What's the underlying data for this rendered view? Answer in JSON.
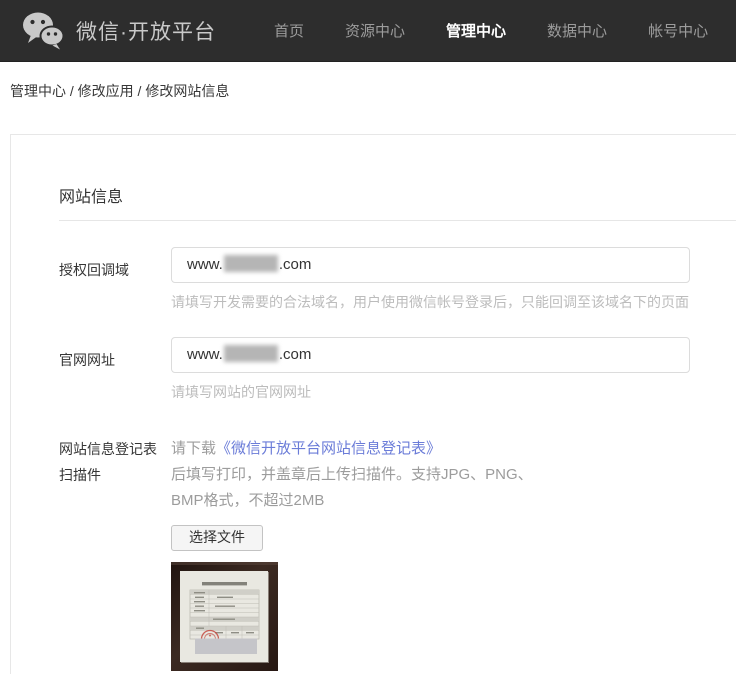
{
  "header": {
    "brand": "微信·开放平台",
    "nav": [
      {
        "label": "首页",
        "active": false
      },
      {
        "label": "资源中心",
        "active": false
      },
      {
        "label": "管理中心",
        "active": true
      },
      {
        "label": "数据中心",
        "active": false
      },
      {
        "label": "帐号中心",
        "active": false
      }
    ]
  },
  "breadcrumb": {
    "items": [
      "管理中心",
      "修改应用",
      "修改网站信息"
    ],
    "separator": " / "
  },
  "panel": {
    "section_title": "网站信息",
    "callback_domain": {
      "label": "授权回调域",
      "value_prefix": "www.",
      "value_redacted": "[redacted]",
      "value_suffix": ".com",
      "hint": "请填写开发需要的合法域名，用户使用微信帐号登录后，只能回调至该域名下的页面"
    },
    "site_url": {
      "label": "官网网址",
      "value_prefix": "www.",
      "value_redacted": "[redacted]",
      "value_suffix": ".com",
      "hint": "请填写网站的官网网址"
    },
    "registration_form": {
      "label_line1": "网站信息登记表",
      "label_line2": "扫描件",
      "desc_prefix": "请下载",
      "link_text": "《微信开放平台网站信息登记表》",
      "desc_line2": "后填写打印，并盖章后上传扫描件。支持JPG、PNG、",
      "desc_line3": "BMP格式，不超过2MB",
      "button_label": "选择文件",
      "thumbnail": "uploaded-registration-form-scan-photo"
    }
  },
  "colors": {
    "header_bg": "#2d2d2d",
    "nav_active": "#ffffff",
    "nav_inactive": "#9c9c9c",
    "link_blue": "#6b7cd8",
    "hint_gray": "#bcbcbc",
    "input_border": "#dcdcdc",
    "stamp_red": "#c4493f"
  }
}
